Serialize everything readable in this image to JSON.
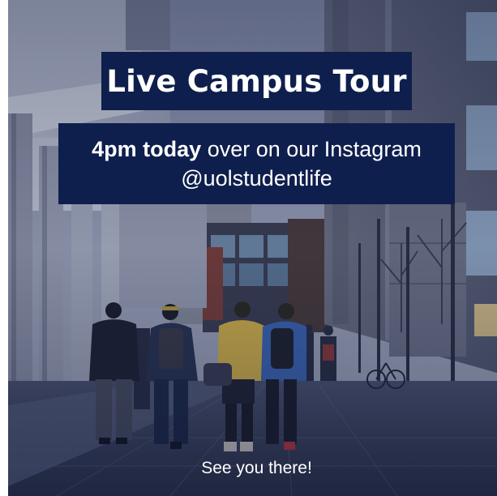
{
  "poster": {
    "title": "Live Campus Tour",
    "time_bold": "4pm today",
    "time_rest": " over on our Instagram",
    "handle": "@uolstudentlife",
    "footer": "See you there!"
  },
  "colors": {
    "banner_navy": "#0f1f4d",
    "text": "#ffffff",
    "accent_gold": "#e8b04a"
  }
}
